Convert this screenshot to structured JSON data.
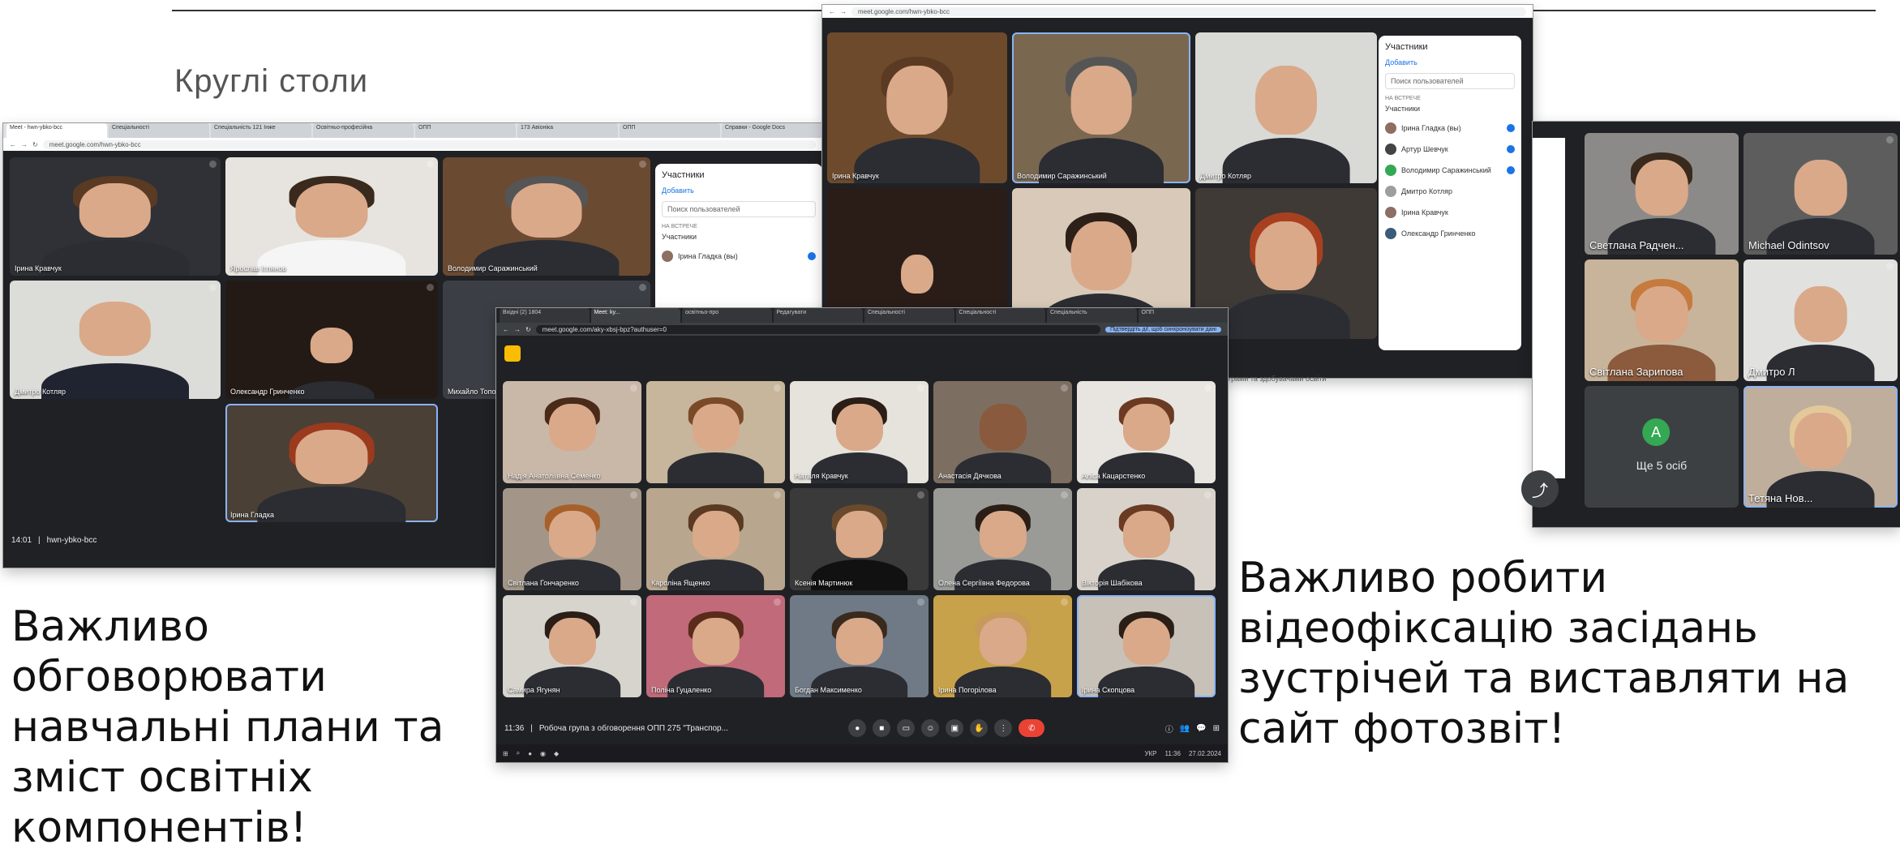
{
  "slide": {
    "title": "Круглі столи",
    "caption_left": "Важливо обговорювати навчальні плани та зміст освітніх компонентів!",
    "caption_right": "Важливо робити відеофіксацію засідань зустрічей та виставляти на сайт фотозвіт!"
  },
  "shot_left": {
    "url": "meet.google.com/hwn-ybko-bcc",
    "tabs": [
      "Meet - hwn-ybko-bcc",
      "Спеціальності",
      "Спеціальність 121 Інже",
      "Освітньо-професійна",
      "ОПП",
      "173 Авіоніка",
      "ОПП",
      "Справки - Google Docs"
    ],
    "tiles": [
      {
        "name": "Ірина Кравчук"
      },
      {
        "name": "Ярослав Іглянов"
      },
      {
        "name": "Володимир Саражинський"
      },
      {
        "name": "Дмитро Котляр"
      },
      {
        "name": "Олександр Гринченко"
      },
      {
        "name": "Михайло Топоров"
      },
      {
        "name": "Ірина Гладка"
      }
    ],
    "time": "14:01",
    "meeting_code": "hwn-ybko-bcc",
    "panel": {
      "title": "Участники",
      "add": "Добавить",
      "search": "Поиск пользователей",
      "section": "НА ВСТРЕЧЕ",
      "group": "Участники",
      "rows": [
        "Ірина Гладка (вы)"
      ]
    }
  },
  "shot_top": {
    "url": "meet.google.com/hwn-ybko-bcc",
    "tiles": [
      {
        "name": "Ірина Кравчук"
      },
      {
        "name": "Володимир Саражинський"
      },
      {
        "name": "Дмитро Котляр"
      },
      {
        "name": ""
      },
      {
        "name": ""
      },
      {
        "name": ""
      }
    ],
    "panel": {
      "title": "Участники",
      "add": "Добавить",
      "search": "Поиск пользователей",
      "section": "НА ВСТРЕЧЕ",
      "group": "Участники",
      "rows": [
        "Ірина Гладка (вы)",
        "Артур Шевчук",
        "Володимир Саражинський",
        "Дмитро Котляр",
        "Ірина Кравчук",
        "Олександр Гринченко"
      ]
    }
  },
  "shot_right": {
    "tiles": [
      {
        "name": "Светлана Радчен..."
      },
      {
        "name": "Michael Odintsov"
      },
      {
        "name": "Світлана Зарипова"
      },
      {
        "name": "Дмитро Л"
      },
      {
        "name": "Ще 5 осіб",
        "avatar": "A"
      },
      {
        "name": "Тетяна Нов..."
      }
    ],
    "panel_text": "програми та здобувачами освіти"
  },
  "shot_center": {
    "url": "meet.google.com/aky-xbsj-bpz?authuser=0",
    "tabs": [
      "Вхідні (2) 1804",
      "Meet: ky...",
      "освітньо-про",
      "Редагувати",
      "Спеціальності",
      "Спеціальності",
      "Спеціальність",
      "ОПП"
    ],
    "notice": "Підтвердіть дії, щоб синхронізувати дані",
    "tiles": [
      {
        "name": "Надія Анатоліївна Семенко"
      },
      {
        "name": ""
      },
      {
        "name": "Наталя Кравчук"
      },
      {
        "name": "Анастасія Дячкова"
      },
      {
        "name": "Аліса Кацарстенко"
      },
      {
        "name": "Світлана Гончаренко"
      },
      {
        "name": "Кароліна Ященко"
      },
      {
        "name": "Ксенія Мартинюк"
      },
      {
        "name": "Олена Сергіївна Федорова"
      },
      {
        "name": "Вікторія Шабікова"
      },
      {
        "name": "Самира Ягунян"
      },
      {
        "name": "Поліна Гуцаленко"
      },
      {
        "name": "Богдан Максименко"
      },
      {
        "name": "Ірина Погорілова"
      },
      {
        "name": "Ірина Скопцова"
      }
    ],
    "time": "11:36",
    "meeting_title": "Робоча група з обговорення ОПП 275 \"Транспор...",
    "clock": "11:36",
    "date": "27.02.2024",
    "lang": "УКР"
  },
  "colors": {
    "meet_bg": "#202124",
    "tile_bg": "#3c4043",
    "hangup": "#ea4335",
    "accent": "#8ab4f8"
  }
}
